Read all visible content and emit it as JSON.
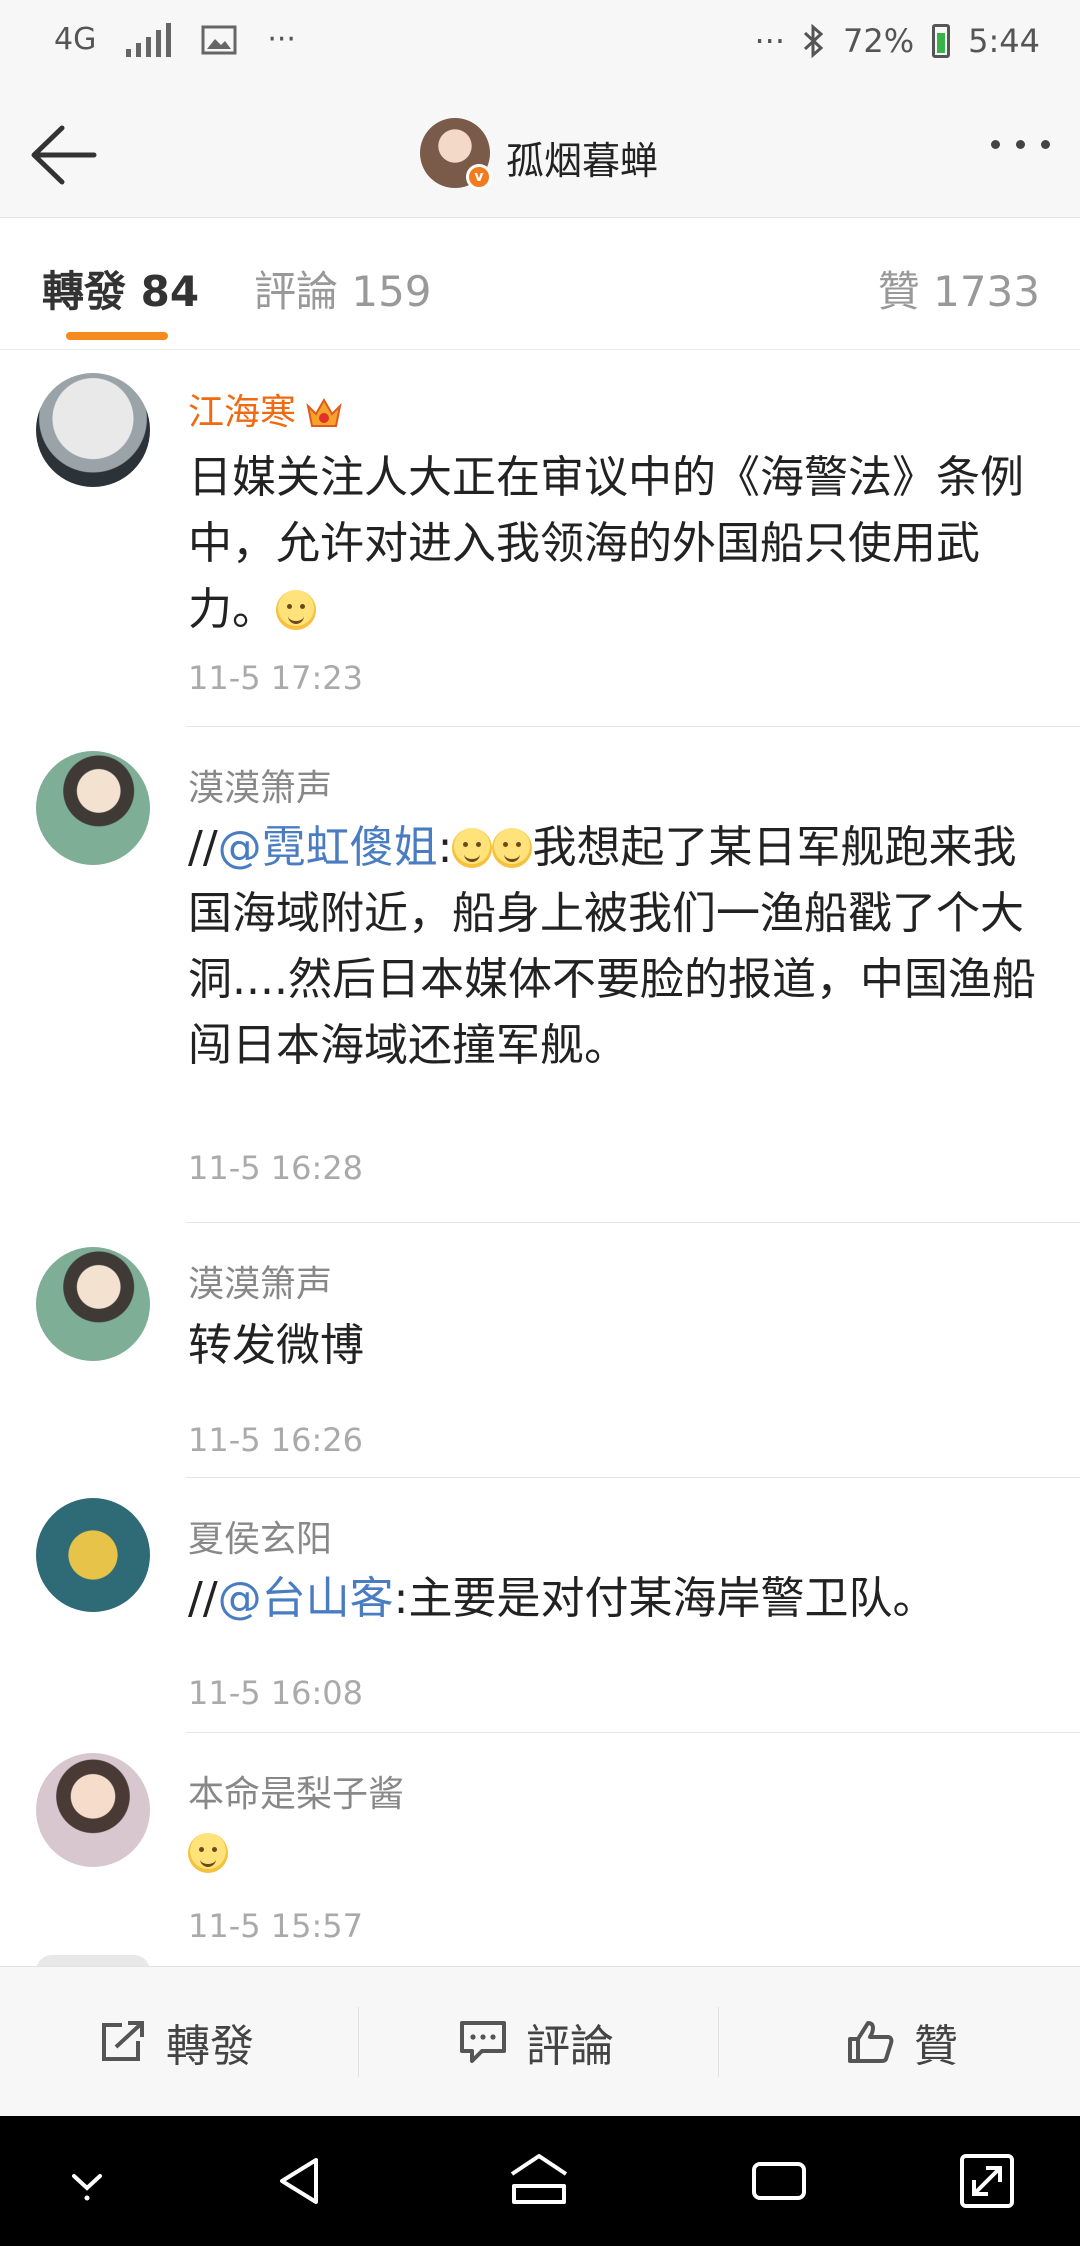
{
  "status_bar": {
    "network": "4G",
    "overflow_left": "···",
    "overflow_right": "···",
    "battery": "72%",
    "time": "5:44"
  },
  "header": {
    "title": "孤烟暮蝉",
    "back_icon": "arrow-left-icon",
    "more_icon": "more-horizontal-icon"
  },
  "tabs": [
    {
      "label": "轉發 84",
      "active": true
    },
    {
      "label": "評論 159",
      "active": false
    },
    {
      "label": "贊 1733",
      "active": false
    }
  ],
  "feed": [
    {
      "name": "江海寒",
      "vip": true,
      "text_parts": [
        "日媒关注人大正在审议中的《海警法》条例中，允许对进入我领海的外国船只使用武力。"
      ],
      "time": "11-5 17:23"
    },
    {
      "name": "漠漠箫声",
      "prefix": "//",
      "mention": "@霓虹傻姐",
      "body": ":",
      "rest": "我想起了某日军舰跑来我国海域附近，船身上被我们一渔船戳了个大洞....然后日本媒体不要脸的报道，中国渔船闯日本海域还撞军舰。",
      "time": "11-5 16:28"
    },
    {
      "name": "漠漠箫声",
      "text": "转发微博",
      "time": "11-5 16:26"
    },
    {
      "name": "夏侯玄阳",
      "prefix": "//",
      "mention": "@台山客",
      "rest": ":主要是对付某海岸警卫队。",
      "time": "11-5 16:08"
    },
    {
      "name": "本命是梨子酱",
      "time": "11-5 15:57"
    }
  ],
  "action_bar": {
    "repost": "轉發",
    "comment": "評論",
    "like": "贊"
  },
  "colors": {
    "accent_orange": "#f58a1f",
    "vip_name": "#f06a12",
    "mention_blue": "#4a7cc2"
  }
}
